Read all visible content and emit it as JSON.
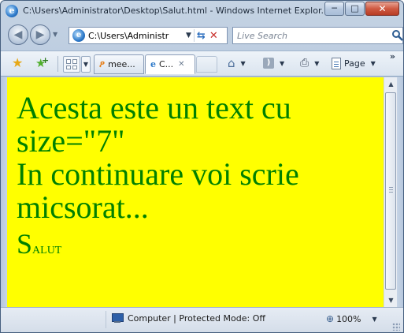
{
  "window": {
    "title": "C:\\Users\\Administrator\\Desktop\\Salut.html - Windows Internet Explor...",
    "minimize_glyph": "─",
    "maximize_glyph": "□",
    "close_glyph": "✕"
  },
  "nav": {
    "back_glyph": "◀",
    "forward_glyph": "▶",
    "dropdown_glyph": "▼",
    "address": "C:\\Users\\Administr",
    "search_placeholder": "Live Search"
  },
  "tabs": [
    {
      "label": "mee...",
      "icon": "orange-page-icon"
    },
    {
      "label": "C...",
      "icon": "ie-page-icon",
      "active": true
    }
  ],
  "commands": {
    "page_label": "Page",
    "more_glyph": "»"
  },
  "content": {
    "line1": "Acesta este un text cu size=\"7\"",
    "line2": "In continuare voi scrie micsorat...",
    "salut_first": "S",
    "salut_rest": "alut",
    "background_color": "#ffff00",
    "text_color": "#008000"
  },
  "status": {
    "zone": "Computer | Protected Mode: Off",
    "zoom": "100%"
  }
}
